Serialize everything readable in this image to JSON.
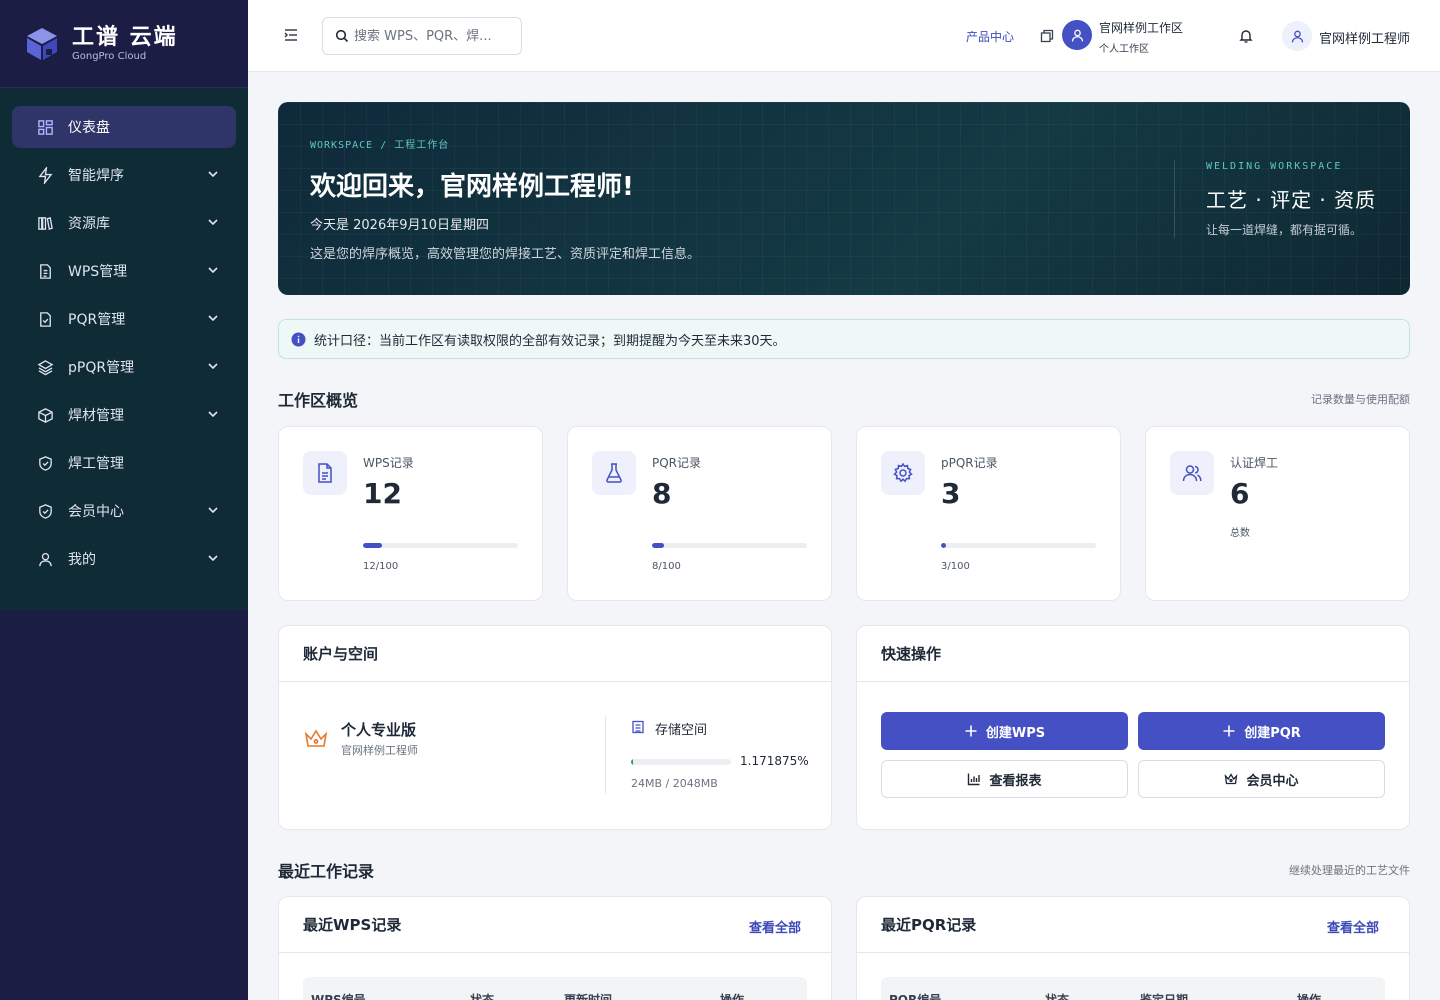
{
  "brand": {
    "title": "工谱 云端",
    "subtitle": "GongPro Cloud"
  },
  "sidebar": {
    "items": [
      {
        "label": "仪表盘",
        "icon": "dashboard-icon",
        "active": true,
        "expandable": false
      },
      {
        "label": "智能焊序",
        "icon": "bolt-icon",
        "expandable": true
      },
      {
        "label": "资源库",
        "icon": "library-icon",
        "expandable": true
      },
      {
        "label": "WPS管理",
        "icon": "document-icon",
        "expandable": true
      },
      {
        "label": "PQR管理",
        "icon": "document-check-icon",
        "expandable": true
      },
      {
        "label": "pPQR管理",
        "icon": "layers-icon",
        "expandable": true
      },
      {
        "label": "焊材管理",
        "icon": "cube-icon",
        "expandable": true
      },
      {
        "label": "焊工管理",
        "icon": "shield-check-icon",
        "expandable": false
      },
      {
        "label": "会员中心",
        "icon": "badge-check-icon",
        "expandable": true
      },
      {
        "label": "我的",
        "icon": "user-icon",
        "expandable": true
      }
    ]
  },
  "header": {
    "search_placeholder": "搜索 WPS、PQR、焊...",
    "product_center": "产品中心",
    "workspace_name": "官网样例工作区",
    "workspace_type": "个人工作区",
    "user_name": "官网样例工程师"
  },
  "hero": {
    "breadcrumb": "WORKSPACE / 工程工作台",
    "title": "欢迎回来，官网样例工程师!",
    "date": "今天是 2026年9月10日星期四",
    "description": "这是您的焊序概览，高效管理您的焊接工艺、资质评定和焊工信息。",
    "tag": "WELDING WORKSPACE",
    "motto": "工艺 · 评定 · 资质",
    "slogan": "让每一道焊缝，都有据可循。"
  },
  "notice": "统计口径：当前工作区有读取权限的全部有效记录；到期提醒为今天至未来30天。",
  "overview": {
    "title": "工作区概览",
    "note": "记录数量与使用配额",
    "cards": [
      {
        "label": "WPS记录",
        "value": "12",
        "usage": "12/100",
        "fraction": 0.12,
        "icon": "document-icon"
      },
      {
        "label": "PQR记录",
        "value": "8",
        "usage": "8/100",
        "fraction": 0.08,
        "icon": "flask-icon"
      },
      {
        "label": "pPQR记录",
        "value": "3",
        "usage": "3/100",
        "fraction": 0.03,
        "icon": "gear-icon"
      },
      {
        "label": "认证焊工",
        "value": "6",
        "sub": "总数",
        "icon": "users-icon"
      }
    ]
  },
  "account": {
    "title": "账户与空间",
    "plan": "个人专业版",
    "owner": "官网样例工程师",
    "storage_label": "存储空间",
    "storage_percent": "1.171875%",
    "storage_fraction": 0.01171875,
    "storage_usage": "24MB / 2048MB"
  },
  "quick_actions": {
    "title": "快速操作",
    "create_wps": "创建WPS",
    "create_pqr": "创建PQR",
    "view_reports": "查看报表",
    "member_center": "会员中心"
  },
  "recent": {
    "title": "最近工作记录",
    "note": "继续处理最近的工艺文件",
    "wps": {
      "title": "最近WPS记录",
      "view_all": "查看全部",
      "columns": [
        "WPS编号",
        "状态",
        "更新时间",
        "操作"
      ]
    },
    "pqr": {
      "title": "最近PQR记录",
      "view_all": "查看全部",
      "columns": [
        "PQR编号",
        "状态",
        "鉴定日期",
        "操作"
      ]
    }
  },
  "colors": {
    "accent": "#4450c4",
    "sidebar": "#1b1d45",
    "hero": "#122b3a",
    "teal": "#1f9d8b"
  }
}
